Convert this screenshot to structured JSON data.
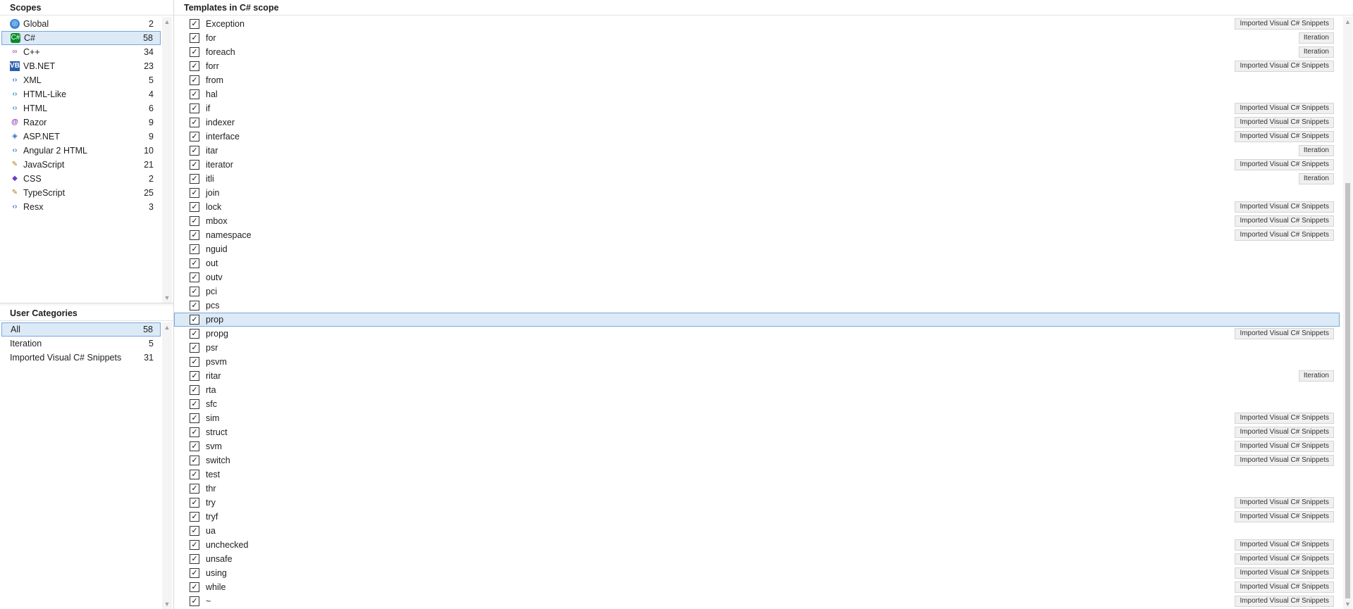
{
  "scopes": {
    "title": "Scopes",
    "items": [
      {
        "label": "Global",
        "count": "2",
        "icon": "globe-icon",
        "glyph": "◎"
      },
      {
        "label": "C#",
        "count": "58",
        "icon": "csharp-icon",
        "glyph": "C#",
        "selected": true
      },
      {
        "label": "C++",
        "count": "34",
        "icon": "cpp-icon",
        "glyph": "∞"
      },
      {
        "label": "VB.NET",
        "count": "23",
        "icon": "vbnet-icon",
        "glyph": "VB"
      },
      {
        "label": "XML",
        "count": "5",
        "icon": "xml-icon",
        "glyph": "‹›"
      },
      {
        "label": "HTML-Like",
        "count": "4",
        "icon": "html-like-icon",
        "glyph": "‹›"
      },
      {
        "label": "HTML",
        "count": "6",
        "icon": "html-icon",
        "glyph": "‹›"
      },
      {
        "label": "Razor",
        "count": "9",
        "icon": "razor-icon",
        "glyph": "@"
      },
      {
        "label": "ASP.NET",
        "count": "9",
        "icon": "aspnet-icon",
        "glyph": "◈"
      },
      {
        "label": "Angular 2 HTML",
        "count": "10",
        "icon": "angular-icon",
        "glyph": "‹›"
      },
      {
        "label": "JavaScript",
        "count": "21",
        "icon": "javascript-icon",
        "glyph": "✎"
      },
      {
        "label": "CSS",
        "count": "2",
        "icon": "css-icon",
        "glyph": "◆"
      },
      {
        "label": "TypeScript",
        "count": "25",
        "icon": "typescript-icon",
        "glyph": "✎"
      },
      {
        "label": "Resx",
        "count": "3",
        "icon": "resx-icon",
        "glyph": "‹›"
      }
    ]
  },
  "user_categories": {
    "title": "User Categories",
    "items": [
      {
        "label": "All",
        "count": "58",
        "selected": true
      },
      {
        "label": "Iteration",
        "count": "5"
      },
      {
        "label": "Imported Visual C# Snippets",
        "count": "31"
      }
    ]
  },
  "templates": {
    "title": "Templates in C# scope",
    "checkmark": "✓",
    "items": [
      {
        "name": "Exception",
        "category": "Imported Visual C# Snippets"
      },
      {
        "name": "for",
        "category": "Iteration"
      },
      {
        "name": "foreach",
        "category": "Iteration"
      },
      {
        "name": "forr",
        "category": "Imported Visual C# Snippets"
      },
      {
        "name": "from",
        "category": ""
      },
      {
        "name": "hal",
        "category": ""
      },
      {
        "name": "if",
        "category": "Imported Visual C# Snippets"
      },
      {
        "name": "indexer",
        "category": "Imported Visual C# Snippets"
      },
      {
        "name": "interface",
        "category": "Imported Visual C# Snippets"
      },
      {
        "name": "itar",
        "category": "Iteration"
      },
      {
        "name": "iterator",
        "category": "Imported Visual C# Snippets"
      },
      {
        "name": "itli",
        "category": "Iteration"
      },
      {
        "name": "join",
        "category": ""
      },
      {
        "name": "lock",
        "category": "Imported Visual C# Snippets"
      },
      {
        "name": "mbox",
        "category": "Imported Visual C# Snippets"
      },
      {
        "name": "namespace",
        "category": "Imported Visual C# Snippets"
      },
      {
        "name": "nguid",
        "category": ""
      },
      {
        "name": "out",
        "category": ""
      },
      {
        "name": "outv",
        "category": ""
      },
      {
        "name": "pci",
        "category": ""
      },
      {
        "name": "pcs",
        "category": ""
      },
      {
        "name": "prop",
        "category": "",
        "selected": true
      },
      {
        "name": "propg",
        "category": "Imported Visual C# Snippets"
      },
      {
        "name": "psr",
        "category": ""
      },
      {
        "name": "psvm",
        "category": ""
      },
      {
        "name": "ritar",
        "category": "Iteration"
      },
      {
        "name": "rta",
        "category": ""
      },
      {
        "name": "sfc",
        "category": ""
      },
      {
        "name": "sim",
        "category": "Imported Visual C# Snippets"
      },
      {
        "name": "struct",
        "category": "Imported Visual C# Snippets"
      },
      {
        "name": "svm",
        "category": "Imported Visual C# Snippets"
      },
      {
        "name": "switch",
        "category": "Imported Visual C# Snippets"
      },
      {
        "name": "test",
        "category": ""
      },
      {
        "name": "thr",
        "category": ""
      },
      {
        "name": "try",
        "category": "Imported Visual C# Snippets"
      },
      {
        "name": "tryf",
        "category": "Imported Visual C# Snippets"
      },
      {
        "name": "ua",
        "category": ""
      },
      {
        "name": "unchecked",
        "category": "Imported Visual C# Snippets"
      },
      {
        "name": "unsafe",
        "category": "Imported Visual C# Snippets"
      },
      {
        "name": "using",
        "category": "Imported Visual C# Snippets"
      },
      {
        "name": "while",
        "category": "Imported Visual C# Snippets"
      },
      {
        "name": "~",
        "category": "Imported Visual C# Snippets"
      }
    ]
  },
  "colors": {
    "selection_bg": "#dce9f7",
    "selection_border": "#7aa7d8"
  }
}
